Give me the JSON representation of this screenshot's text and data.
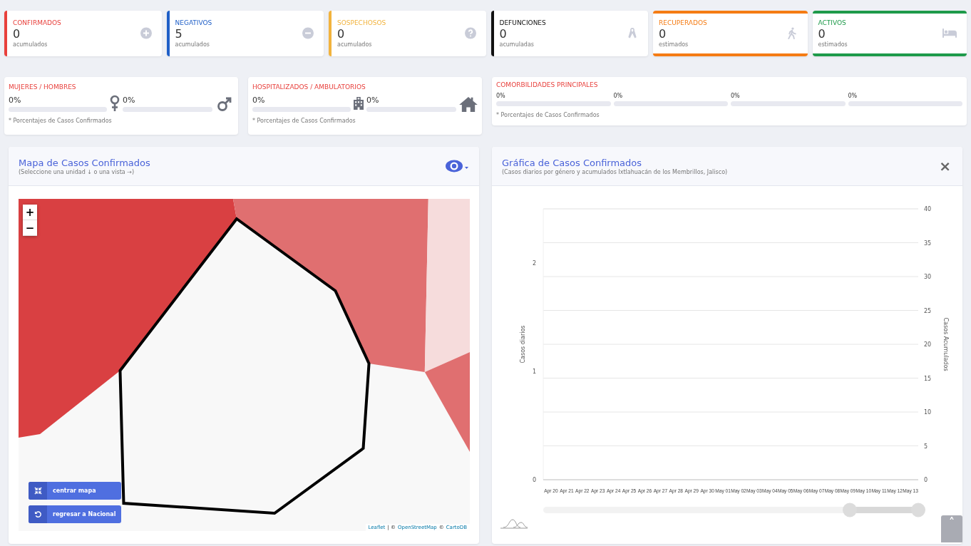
{
  "cards": [
    {
      "title": "CONFIRMADOS",
      "value": "0",
      "note": "acumulados",
      "color": "#e8403c",
      "kind": "side"
    },
    {
      "title": "NEGATIVOS",
      "value": "5",
      "note": "acumulados",
      "color": "#1f5fc7",
      "kind": "side"
    },
    {
      "title": "SOSPECHOSOS",
      "value": "0",
      "note": "acumulados",
      "color": "#f2b33d",
      "kind": "side"
    },
    {
      "title": "DEFUNCIONES",
      "value": "0",
      "note": "acumuladas",
      "color": "#111111",
      "kind": "side"
    },
    {
      "title": "RECUPERADOS",
      "value": "0",
      "note": "estimados",
      "color": "#f57c14",
      "kind": "frame"
    },
    {
      "title": "ACTIVOS",
      "value": "0",
      "note": "estimados",
      "color": "#1e9a4a",
      "kind": "frame"
    }
  ],
  "stats": [
    {
      "title": "MUJERES / HOMBRES",
      "note": "* Porcentajes  de Casos Confirmados",
      "items": [
        {
          "value": "0%",
          "level": 0
        },
        {
          "value": "0%",
          "level": 0
        }
      ]
    },
    {
      "title": "HOSPITALIZADOS / AMBULATORIOS",
      "note": "* Porcentajes  de Casos Confirmados",
      "items": [
        {
          "value": "0%",
          "level": 0
        },
        {
          "value": "0%",
          "level": 0
        }
      ]
    },
    {
      "title": "COMORBILIDADES PRINCIPALES",
      "note": "* Porcentajes  de Casos Confirmados",
      "items": [
        {
          "value": "0%",
          "level": 0
        },
        {
          "value": "0%",
          "level": 0
        },
        {
          "value": "0%",
          "level": 0
        },
        {
          "value": "0%",
          "level": 0
        }
      ]
    }
  ],
  "map_panel": {
    "title": "Mapa de Casos Confirmados",
    "subtitle": "(Seleccione una unidad ↓ o una vista →)",
    "zoom_in": "+",
    "zoom_out": "−",
    "buttons": [
      "centrar mapa",
      "regresar a Nacional"
    ],
    "attribution": {
      "links": [
        "Leaflet",
        "OpenStreetMap",
        "CartoDB"
      ],
      "separators": [
        "|  ©",
        "©"
      ]
    }
  },
  "chart_panel": {
    "title": "Gráfica de Casos Confirmados",
    "subtitle": "(Casos diarios por género y acumulados Ixtlahuacán de los Membrillos, Jalisco)",
    "close": "×",
    "scroll_top": "˄",
    "chart_data": {
      "type": "line",
      "ylabel": "Casos diarios",
      "categories": [
        "Apr 20",
        "Apr 21",
        "Apr 22",
        "Apr 23",
        "Apr 24",
        "Apr 25",
        "Apr 26",
        "Apr 27",
        "Apr 28",
        "Apr 29",
        "Apr 30",
        "May 01",
        "May 02",
        "May 03",
        "May 04",
        "May 05",
        "May 06",
        "May 07",
        "May 08",
        "May 09",
        "May 10",
        "May 11",
        "May 12",
        "May 13"
      ],
      "ylim": [
        0,
        2.5
      ],
      "yticks": [
        0,
        1,
        2
      ]
    },
    "secondary_axis": {
      "label": "Casos Acumulados",
      "ticks": [
        "40",
        "35",
        "30",
        "25",
        "20",
        "15",
        "10",
        "5",
        "0"
      ]
    }
  }
}
